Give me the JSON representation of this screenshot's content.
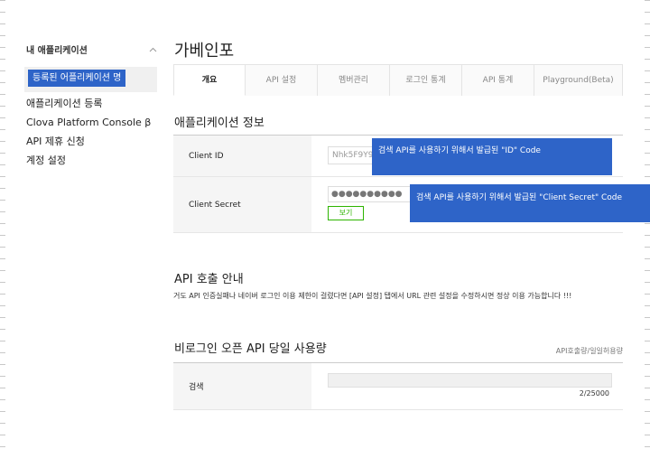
{
  "sidebar": {
    "title": "내 애플리케이션",
    "selected_label": "등록된 어플리케이션 명",
    "items": [
      {
        "label": "애플리케이션 등록"
      },
      {
        "label": "Clova Platform Console β"
      },
      {
        "label": "API 제휴 신청"
      },
      {
        "label": "계정 설정"
      }
    ]
  },
  "main": {
    "title": "가베인포",
    "tabs": [
      {
        "label": "개요",
        "active": true
      },
      {
        "label": "API 설정"
      },
      {
        "label": "멤버관리"
      },
      {
        "label": "로그인 통계"
      },
      {
        "label": "API 통계"
      },
      {
        "label": "Playground(Beta)"
      }
    ],
    "app_info": {
      "title": "애플리케이션 정보",
      "client_id_label": "Client ID",
      "client_id_value": "Nhk5F9Y9C",
      "client_secret_label": "Client Secret",
      "client_secret_value": "●●●●●●●●●●",
      "show_button": "보기",
      "note_id": "검색 API를 사용하기 위해서  발급된 \"ID\" Code",
      "note_secret": "검색 API를 사용하기 위해서  발급된 \"Client Secret\" Code"
    },
    "api_guide": {
      "title": "API 호출 안내",
      "text": "거도 API 인증실패나 네이버 로그인 이용 제한이 걸렸다면 [API 설정] 탭에서 URL 관련 설정을 수정하시면 정상 이용 가능합니다 !!!"
    },
    "usage": {
      "title": "비로그인 오픈 API 당일 사용량",
      "caption": "API호출량/일일허용량",
      "rows": [
        {
          "label": "검색",
          "count": "2/25000",
          "used": 2,
          "limit": 25000
        }
      ]
    }
  },
  "colors": {
    "accent_blue": "#2e64c8",
    "green": "#2db400"
  }
}
